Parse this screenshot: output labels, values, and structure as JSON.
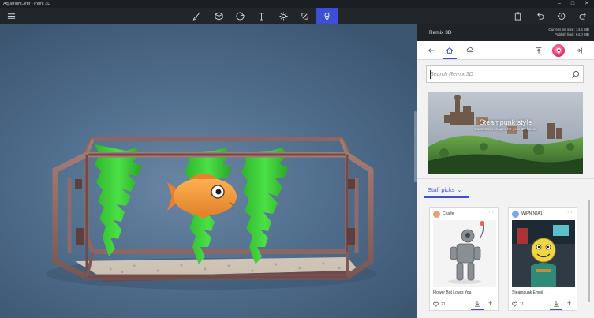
{
  "window": {
    "title": "Aquarium.3mf - Paint 3D",
    "controls": {
      "minimize": "–",
      "maximize": "□",
      "close": "✕"
    }
  },
  "toolbar": {
    "menu_icon": "hamburger-menu-icon",
    "tools": [
      {
        "name": "brushes",
        "icon": "brush-icon"
      },
      {
        "name": "3d-shapes",
        "icon": "cube-icon"
      },
      {
        "name": "stickers",
        "icon": "sticker-icon"
      },
      {
        "name": "text",
        "icon": "text-icon"
      },
      {
        "name": "effects",
        "icon": "sun-icon"
      },
      {
        "name": "canvas",
        "icon": "canvas-icon"
      },
      {
        "name": "remix-3d",
        "icon": "remix3d-icon",
        "active": true
      }
    ],
    "right_icons": [
      "paste-icon",
      "undo-icon",
      "history-icon",
      "redo-icon"
    ]
  },
  "panel": {
    "title": "Remix 3D",
    "file_size_line": "Current file size: 14.5 MB",
    "publish_limit_line": "Publish limit: 64.0 MB",
    "search_placeholder": "Search Remix 3D",
    "hero": {
      "title": "Steampunk style",
      "subtitle": "Fantastical shapes for your 3D builds"
    },
    "section_title": "Staff picks",
    "cards": [
      {
        "author": "Chalfe",
        "title": "Flower Bot Loves You",
        "likes": "21",
        "avatar_color": "#e8a07a"
      },
      {
        "author": "WIPNINJA1",
        "title": "Steampunk Emoji",
        "likes": "11",
        "avatar_color": "#7aa6e8"
      }
    ],
    "more_glyph": "···",
    "plus_glyph": "+"
  },
  "colors": {
    "accent": "#3c4fd6",
    "titlebar": "#1b1e22",
    "toolbar": "#22262b",
    "seaweed": "#3fcc3a",
    "fish": "#f39a3b"
  }
}
